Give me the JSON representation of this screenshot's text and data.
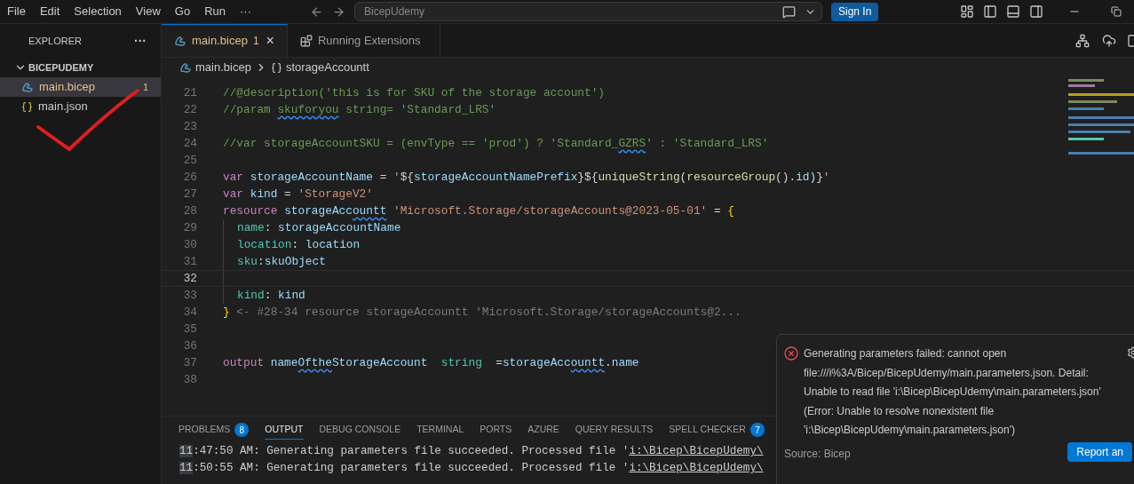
{
  "menu": [
    "File",
    "Edit",
    "Selection",
    "View",
    "Go",
    "Run",
    "···"
  ],
  "search": {
    "value": "BicepUdemy"
  },
  "sign_in": "Sign In",
  "sidebar": {
    "title": "EXPLORER",
    "more": "···",
    "folder": {
      "name": "BICEPUDEMY",
      "expanded": true,
      "files": [
        {
          "name": "main.bicep",
          "kind": "bicep",
          "selected": true,
          "badge": "1"
        },
        {
          "name": "main.json",
          "kind": "json",
          "selected": false
        }
      ]
    }
  },
  "tabs": [
    {
      "label": "main.bicep",
      "kind": "bicep",
      "selected": true,
      "badge": "1",
      "close": "×"
    },
    {
      "label": "Running Extensions",
      "kind": "extensions",
      "selected": false
    }
  ],
  "breadcrumb": {
    "file": "main.bicep",
    "symbol": "storageAccountt"
  },
  "code": [
    {
      "number": "21",
      "current": false,
      "indented": false,
      "tokens": [
        {
          "kind": "comment",
          "text": "//@description('this is for SKU of the storage account')"
        }
      ]
    },
    {
      "number": "22",
      "current": false,
      "indented": false,
      "tokens": [
        {
          "kind": "comment",
          "text": "//param "
        },
        {
          "kind": "comment",
          "text": "skuforyou",
          "squiggle": true
        },
        {
          "kind": "comment",
          "text": " string= 'Standard_LRS'"
        }
      ]
    },
    {
      "number": "23",
      "current": false,
      "indented": false
    },
    {
      "number": "24",
      "current": false,
      "indented": false,
      "tokens": [
        {
          "kind": "comment",
          "text": "//var storageAccountSKU = (envType == 'prod') ? 'Standard_"
        },
        {
          "kind": "comment",
          "text": "GZRS",
          "squiggle": true
        },
        {
          "kind": "comment",
          "text": "' : 'Standard_LRS'"
        }
      ]
    },
    {
      "number": "25",
      "current": false,
      "indented": false
    },
    {
      "number": "26",
      "current": false,
      "indented": false,
      "tokens": [
        {
          "kind": "keyword",
          "text": "var "
        },
        {
          "kind": "variable",
          "text": "storageAccountName"
        },
        {
          "kind": "plain",
          "text": " = "
        },
        {
          "kind": "string",
          "text": "'"
        },
        {
          "kind": "plain",
          "text": "${"
        },
        {
          "kind": "variable",
          "text": "storageAccountNamePrefix"
        },
        {
          "kind": "plain",
          "text": "}${"
        },
        {
          "kind": "function",
          "text": "uniqueString"
        },
        {
          "kind": "plain",
          "text": "("
        },
        {
          "kind": "function",
          "text": "resourceGroup"
        },
        {
          "kind": "plain",
          "text": "()."
        },
        {
          "kind": "variable",
          "text": "id"
        },
        {
          "kind": "plain",
          "text": ")}"
        },
        {
          "kind": "string",
          "text": "'"
        }
      ]
    },
    {
      "number": "27",
      "current": false,
      "indented": false,
      "tokens": [
        {
          "kind": "keyword",
          "text": "var "
        },
        {
          "kind": "variable",
          "text": "kind"
        },
        {
          "kind": "plain",
          "text": " = "
        },
        {
          "kind": "string",
          "text": "'StorageV2'"
        }
      ]
    },
    {
      "number": "28",
      "current": false,
      "indented": false,
      "tokens": [
        {
          "kind": "keyword",
          "text": "resource "
        },
        {
          "kind": "variable",
          "text": "storageAcc"
        },
        {
          "kind": "variable",
          "text": "ountt",
          "squiggle": true
        },
        {
          "kind": "string",
          "text": " 'Microsoft.Storage/storageAccounts@2023-05-01'"
        },
        {
          "kind": "plain",
          "text": " = "
        },
        {
          "kind": "brace",
          "text": "{"
        }
      ]
    },
    {
      "number": "29",
      "current": false,
      "indented": true,
      "tokens": [
        {
          "kind": "property",
          "text": "name"
        },
        {
          "kind": "plain",
          "text": ": "
        },
        {
          "kind": "variable",
          "text": "storageAccountName"
        }
      ]
    },
    {
      "number": "30",
      "current": false,
      "indented": true,
      "tokens": [
        {
          "kind": "property",
          "text": "location"
        },
        {
          "kind": "plain",
          "text": ": "
        },
        {
          "kind": "variable",
          "text": "location"
        }
      ]
    },
    {
      "number": "31",
      "current": false,
      "indented": true,
      "tokens": [
        {
          "kind": "property",
          "text": "sku"
        },
        {
          "kind": "plain",
          "text": ":"
        },
        {
          "kind": "variable",
          "text": "skuObject"
        }
      ]
    },
    {
      "number": "32",
      "current": true,
      "indented": true
    },
    {
      "number": "33",
      "current": false,
      "indented": true,
      "tokens": [
        {
          "kind": "property",
          "text": "kind"
        },
        {
          "kind": "plain",
          "text": ": "
        },
        {
          "kind": "variable",
          "text": "kind"
        }
      ]
    },
    {
      "number": "34",
      "current": false,
      "indented": false,
      "tokens": [
        {
          "kind": "brace",
          "text": "}"
        },
        {
          "kind": "hint",
          "text": " <- #28-34 resource storageAccountt 'Microsoft.Storage/storageAccounts@2..."
        }
      ]
    },
    {
      "number": "35",
      "current": false,
      "indented": false
    },
    {
      "number": "36",
      "current": false,
      "indented": false
    },
    {
      "number": "37",
      "current": false,
      "indented": false,
      "tokens": [
        {
          "kind": "keyword",
          "text": "output "
        },
        {
          "kind": "variable",
          "text": "name"
        },
        {
          "kind": "variable",
          "text": "Ofthe",
          "squiggle": true
        },
        {
          "kind": "variable",
          "text": "StorageAccount  "
        },
        {
          "kind": "type",
          "text": "string"
        },
        {
          "kind": "plain",
          "text": "  ="
        },
        {
          "kind": "variable",
          "text": "storageAcc"
        },
        {
          "kind": "variable",
          "text": "ountt",
          "squiggle": true
        },
        {
          "kind": "plain",
          "text": "."
        },
        {
          "kind": "variable",
          "text": "name"
        }
      ]
    },
    {
      "number": "38",
      "current": false,
      "indented": false
    }
  ],
  "panel": {
    "tabs": [
      {
        "label": "PROBLEMS",
        "selected": false,
        "badge": "8"
      },
      {
        "label": "OUTPUT",
        "selected": true
      },
      {
        "label": "DEBUG CONSOLE",
        "selected": false
      },
      {
        "label": "TERMINAL",
        "selected": false
      },
      {
        "label": "PORTS",
        "selected": false
      },
      {
        "label": "AZURE",
        "selected": false
      },
      {
        "label": "QUERY RESULTS",
        "selected": false
      },
      {
        "label": "SPELL CHECKER",
        "selected": false,
        "badge": "7"
      }
    ],
    "output": [
      {
        "hour": "11",
        "text": ":47:50 AM: Generating parameters file succeeded. Processed file '",
        "link": "i:\\Bicep\\BicepUdemy\\"
      },
      {
        "hour": "11",
        "text": ":50:55 AM: Generating parameters file succeeded. Processed file '",
        "link": "i:\\Bicep\\BicepUdemy\\"
      }
    ]
  },
  "notification": {
    "message": "Generating parameters failed: cannot open file:///i%3A/Bicep/BicepUdemy/main.parameters.json. Detail: Unable to read file 'i:\\Bicep\\BicepUdemy\\main.parameters.json' (Error: Unable to resolve nonexistent file 'i:\\Bicep\\BicepUdemy\\main.parameters.json')",
    "source": "Source: Bicep",
    "button": "Report an"
  }
}
